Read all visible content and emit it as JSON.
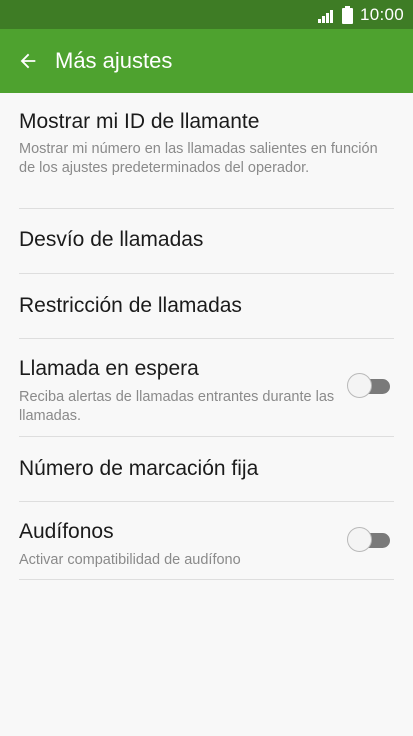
{
  "status_bar": {
    "time": "10:00",
    "icons": [
      "signal-icon",
      "battery-icon"
    ]
  },
  "app_bar": {
    "back_icon": "arrow-left-icon",
    "title": "Más ajustes"
  },
  "colors": {
    "status_bar": "#3e7c25",
    "app_bar": "#4ea22f",
    "background": "#f8f8f8",
    "title_text": "#1b1b1b",
    "subtitle_text": "#8a8a8a",
    "divider": "#dedede"
  },
  "settings": [
    {
      "title": "Mostrar mi ID de llamante",
      "subtitle": "Mostrar mi número en las llamadas salientes en función de los ajustes predeterminados del operador."
    },
    {
      "title": "Desvío de llamadas"
    },
    {
      "title": "Restricción de llamadas"
    },
    {
      "title": "Llamada en espera",
      "subtitle": "Reciba alertas de llamadas entrantes durante las llamadas.",
      "toggle_on": false
    },
    {
      "title": "Número de marcación fija"
    },
    {
      "title": "Audífonos",
      "subtitle": "Activar compatibilidad de audífono",
      "toggle_on": false
    }
  ]
}
